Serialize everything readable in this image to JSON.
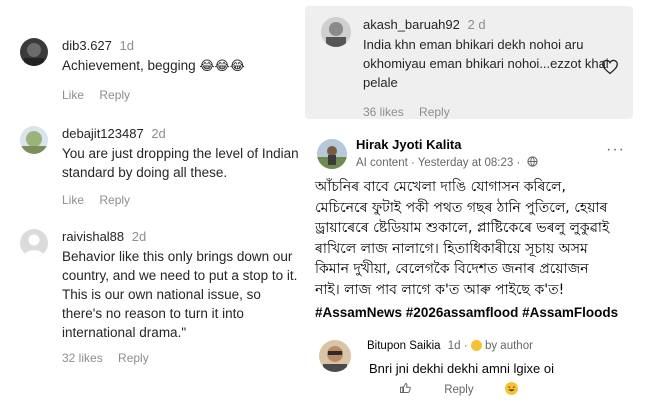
{
  "left_comments": [
    {
      "username": "dib3.627",
      "time": "1d",
      "text": "Achievement, begging",
      "emoji": "😂😂😂",
      "likes": "",
      "like_label": "Like",
      "reply_label": "Reply"
    },
    {
      "username": "debajit123487",
      "time": "2d",
      "text": "You are just dropping the level of Indian standard by doing all these.",
      "likes": "",
      "like_label": "Like",
      "reply_label": "Reply"
    },
    {
      "username": "raivishal88",
      "time": "2d",
      "text": "Behavior like this only brings down our country, and we need to put a stop to it. This is our own national issue, so there's no reason to turn it into international drama.\"",
      "likes": "32 likes",
      "like_label": "",
      "reply_label": "Reply"
    }
  ],
  "right_card": {
    "username": "akash_baruah92",
    "time": "2 d",
    "text": "India khn eman bhikari dekh nohoi aru okhomiyau eman bhikari nohoi...ezzot khai pelale",
    "likes": "36 likes",
    "reply_label": "Reply"
  },
  "fb_post": {
    "author": "Hirak Jyoti Kalita",
    "meta": "AI content · Yesterday at 08:23 ·",
    "more": "···",
    "text": "আঁচনিৰ বাবে মেখেলা দাঙি যোগাসন কৰিলে, মেচিনেৰে ফুটাই পকী পথত গছৰ ঠানি পুতিলে, হেয়াৰ ড্ৰায়াৰেৰে ষ্টেডিয়াম শুকালে, প্লাষ্টিকেৰে ভৰলু লুকুৱাই ৰাখিলে লাজ নালাগে। হিতাধিকাৰীয়ে সূচায় অসম কিমান দুখীয়া, বেলেগকৈ বিদেশত জনাৰ প্ৰয়োজন নাই। লাজ পাব লাগে ক'ত আৰু পাইছে ক'ত!",
    "hashtags": "#AssamNews #2026assamflood #AssamFloods"
  },
  "fb_reply": {
    "name": "Bitupon Saikia",
    "time": "1d",
    "author_label": "by author",
    "text": "Bnri jni dekhi dekhi amni lgixe oi",
    "reply_label": "Reply"
  },
  "colors": {
    "card_bg": "#efefef",
    "muted": "#8e8e8e",
    "fb_muted": "#65676b",
    "emoji": "#f7c136"
  }
}
